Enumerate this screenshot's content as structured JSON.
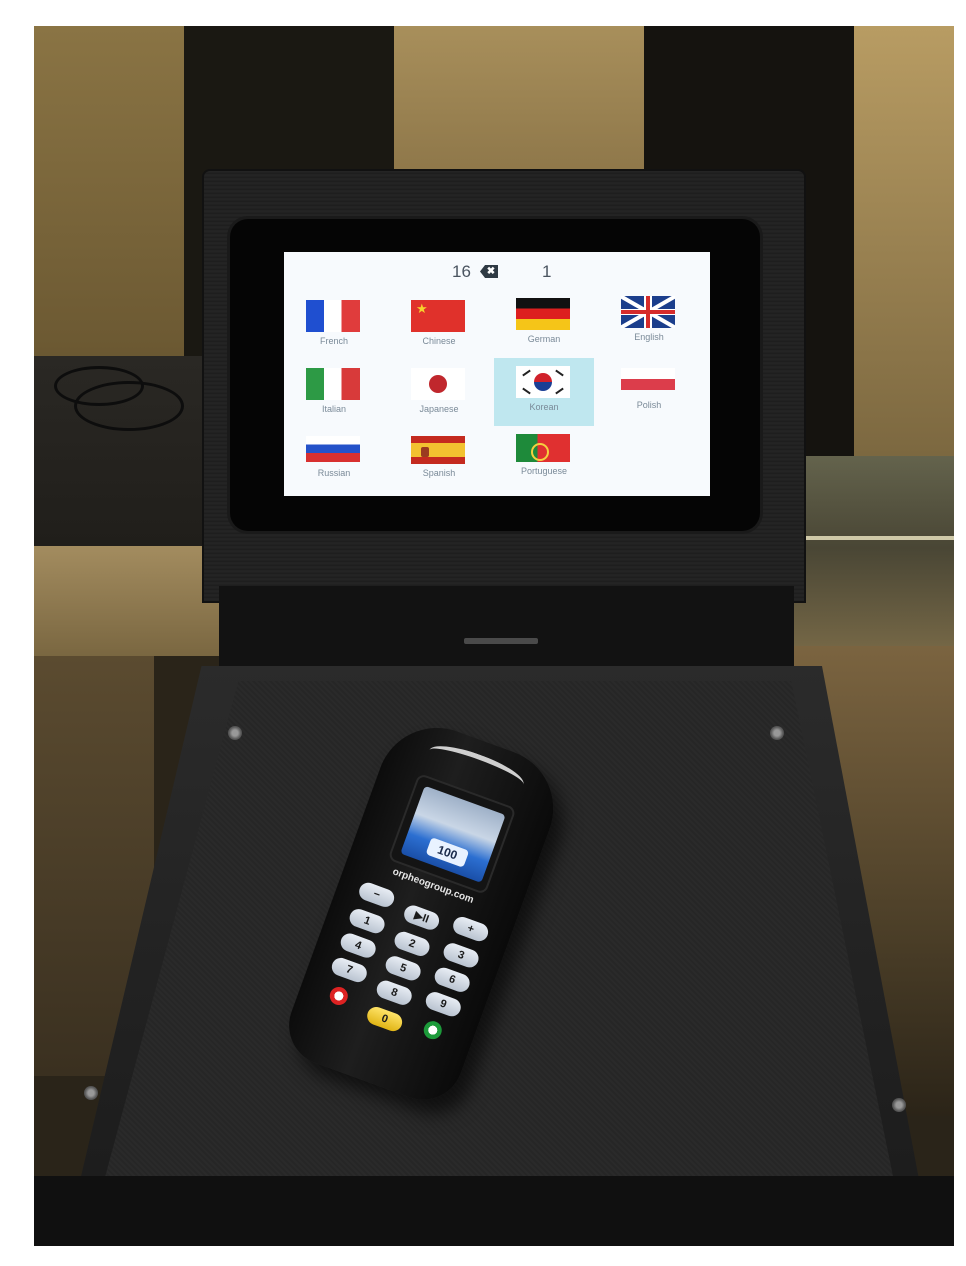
{
  "screen": {
    "counter": "16",
    "delete_symbol": "✖",
    "entry": "1"
  },
  "languages": [
    {
      "label": "French",
      "flag": "france",
      "selected": false
    },
    {
      "label": "Chinese",
      "flag": "china",
      "selected": false
    },
    {
      "label": "German",
      "flag": "germany",
      "selected": false
    },
    {
      "label": "English",
      "flag": "uk",
      "selected": false
    },
    {
      "label": "Italian",
      "flag": "italy",
      "selected": false
    },
    {
      "label": "Japanese",
      "flag": "japan",
      "selected": false
    },
    {
      "label": "Korean",
      "flag": "korea",
      "selected": true
    },
    {
      "label": "Polish",
      "flag": "poland",
      "selected": false
    },
    {
      "label": "Russian",
      "flag": "russia",
      "selected": false
    },
    {
      "label": "Spanish",
      "flag": "spain",
      "selected": false
    },
    {
      "label": "Portuguese",
      "flag": "portugal",
      "selected": false
    }
  ],
  "remote": {
    "display_value": "100",
    "brand_url": "orpheogroup.com",
    "keys": {
      "minus": "−",
      "play_pause": "▶II",
      "plus": "+",
      "k1": "1",
      "k2": "2",
      "k3": "3",
      "k4": "4",
      "k5": "5",
      "k6": "6",
      "k7": "7",
      "k8": "8",
      "k9": "9",
      "k0": "0"
    }
  },
  "colors": {
    "selected_cell": "#bfe7ef",
    "screen_background": "#f7fafd",
    "label_text": "#7a8a98"
  }
}
